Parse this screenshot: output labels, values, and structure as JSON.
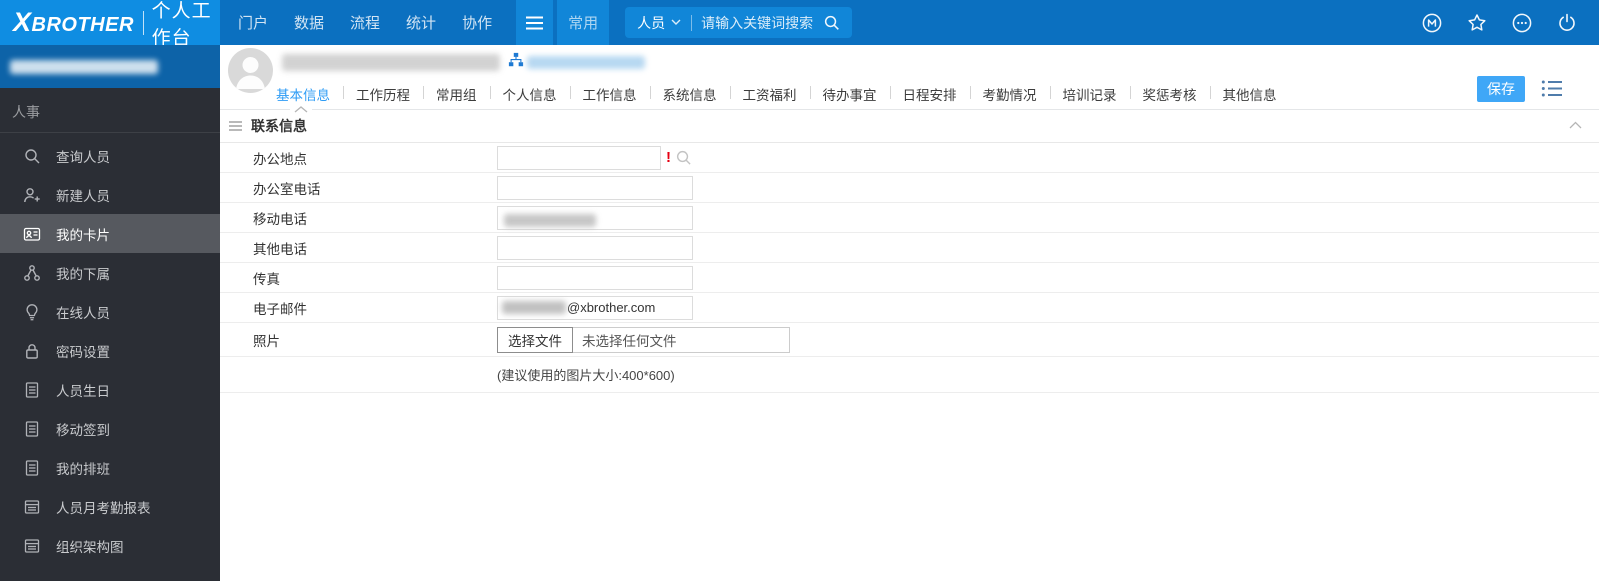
{
  "colors": {
    "logo_block": "#0f8de2",
    "topbar": "#0b70c0",
    "topbar_segment": "#1186d8",
    "sidebar_band": "#0d63a8",
    "sidebar_bg": "#2b2e35",
    "sidebar_active_bg": "#56595f",
    "active_tab": "#2e9cf5",
    "save_button": "#3fa7f7",
    "required_mark": "#e60012"
  },
  "topbar": {
    "logo_text": "XBROTHER",
    "workspace": "个人工作台",
    "nav": [
      "门户",
      "数据",
      "流程",
      "统计",
      "协作"
    ],
    "quick_label": "常用",
    "search": {
      "category": "人员",
      "placeholder": "请输入关键词搜索"
    }
  },
  "sidebar": {
    "section": "人事",
    "items": [
      {
        "label": "查询人员"
      },
      {
        "label": "新建人员"
      },
      {
        "label": "我的卡片",
        "active": true
      },
      {
        "label": "我的下属"
      },
      {
        "label": "在线人员"
      },
      {
        "label": "密码设置"
      },
      {
        "label": "人员生日"
      },
      {
        "label": "移动签到"
      },
      {
        "label": "我的排班"
      },
      {
        "label": "人员月考勤报表"
      },
      {
        "label": "组织架构图"
      }
    ]
  },
  "profile": {
    "tabs": [
      "基本信息",
      "工作历程",
      "常用组",
      "个人信息",
      "工作信息",
      "系统信息",
      "工资福利",
      "待办事宜",
      "日程安排",
      "考勤情况",
      "培训记录",
      "奖惩考核",
      "其他信息"
    ],
    "active_tab": "基本信息",
    "save_label": "保存"
  },
  "form": {
    "section_title": "联系信息",
    "required_mark": "!",
    "fields": [
      {
        "label": "办公地点"
      },
      {
        "label": "办公室电话"
      },
      {
        "label": "移动电话"
      },
      {
        "label": "其他电话"
      },
      {
        "label": "传真"
      },
      {
        "label": "电子邮件"
      },
      {
        "label": "照片"
      }
    ],
    "email_visible": "@xbrother.com",
    "file_button_label": "选择文件",
    "file_empty_text": "未选择任何文件",
    "photo_hint": "(建议使用的图片大小:400*600)"
  }
}
